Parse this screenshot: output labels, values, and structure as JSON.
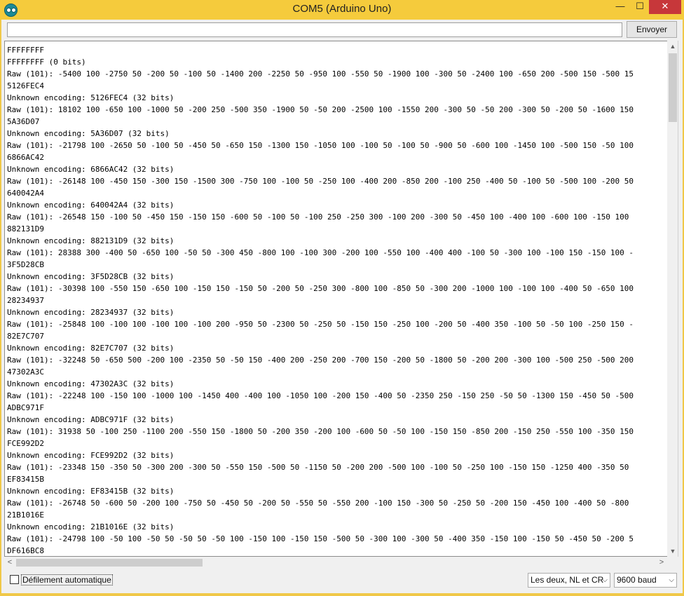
{
  "window": {
    "title": "COM5 (Arduino Uno)",
    "min_glyph": "—",
    "max_glyph": "☐",
    "close_glyph": "✕"
  },
  "toolbar": {
    "input_value": "",
    "send_label": "Envoyer"
  },
  "output": {
    "lines": [
      "FFFFFFFF",
      "FFFFFFFF (0 bits)",
      "Raw (101): -5400 100 -2750 50 -200 50 -100 50 -1400 200 -2250 50 -950 100 -550 50 -1900 100 -300 50 -2400 100 -650 200 -500 150 -500 15",
      "5126FEC4",
      "Unknown encoding: 5126FEC4 (32 bits)",
      "Raw (101): 18102 100 -650 100 -1000 50 -200 250 -500 350 -1900 50 -50 200 -2500 100 -1550 200 -300 50 -50 200 -300 50 -200 50 -1600 150",
      "5A36D07",
      "Unknown encoding: 5A36D07 (32 bits)",
      "Raw (101): -21798 100 -2650 50 -100 50 -450 50 -650 150 -1300 150 -1050 100 -100 50 -100 50 -900 50 -600 100 -1450 100 -500 150 -50 100",
      "6866AC42",
      "Unknown encoding: 6866AC42 (32 bits)",
      "Raw (101): -26148 100 -450 150 -300 150 -1500 300 -750 100 -100 50 -250 100 -400 200 -850 200 -100 250 -400 50 -100 50 -500 100 -200 50",
      "640042A4",
      "Unknown encoding: 640042A4 (32 bits)",
      "Raw (101): -26548 150 -100 50 -450 150 -150 150 -600 50 -100 50 -100 250 -250 300 -100 200 -300 50 -450 100 -400 100 -600 100 -150 100",
      "882131D9",
      "Unknown encoding: 882131D9 (32 bits)",
      "Raw (101): 28388 300 -400 50 -650 100 -50 50 -300 450 -800 100 -100 300 -200 100 -550 100 -400 400 -100 50 -300 100 -100 150 -150 100 -",
      "3F5D28CB",
      "Unknown encoding: 3F5D28CB (32 bits)",
      "Raw (101): -30398 100 -550 150 -650 100 -150 150 -150 50 -200 50 -250 300 -800 100 -850 50 -300 200 -1000 100 -100 100 -400 50 -650 100",
      "28234937",
      "Unknown encoding: 28234937 (32 bits)",
      "Raw (101): -25848 100 -100 100 -100 100 -100 200 -950 50 -2300 50 -250 50 -150 150 -250 100 -200 50 -400 350 -100 50 -50 100 -250 150 -",
      "82E7C707",
      "Unknown encoding: 82E7C707 (32 bits)",
      "Raw (101): -32248 50 -650 500 -200 100 -2350 50 -50 150 -400 200 -250 200 -700 150 -200 50 -1800 50 -200 200 -300 100 -500 250 -500 200",
      "47302A3C",
      "Unknown encoding: 47302A3C (32 bits)",
      "Raw (101): -22248 100 -150 100 -1000 100 -1450 400 -400 100 -1050 100 -200 150 -400 50 -2350 250 -150 250 -50 50 -1300 150 -450 50 -500",
      "ADBC971F",
      "Unknown encoding: ADBC971F (32 bits)",
      "Raw (101): 31938 50 -100 250 -1100 200 -550 150 -1800 50 -200 350 -200 100 -600 50 -50 100 -150 150 -850 200 -150 250 -550 100 -350 150",
      "FCE992D2",
      "Unknown encoding: FCE992D2 (32 bits)",
      "Raw (101): -23348 150 -350 50 -300 200 -300 50 -550 150 -500 50 -1150 50 -200 200 -500 100 -100 50 -250 100 -150 150 -1250 400 -350 50",
      "EF83415B",
      "Unknown encoding: EF83415B (32 bits)",
      "Raw (101): -26748 50 -600 50 -200 100 -750 50 -450 50 -200 50 -550 50 -550 200 -100 150 -300 50 -250 50 -200 150 -450 100 -400 50 -800",
      "21B1016E",
      "Unknown encoding: 21B1016E (32 bits)",
      "Raw (101): -24798 100 -50 100 -50 50 -50 50 -50 100 -150 100 -150 150 -500 50 -300 100 -300 50 -400 350 -150 100 -150 50 -450 50 -200 5",
      "DF616BC8"
    ]
  },
  "footer": {
    "autoscroll_label": "Défilement automatique",
    "autoscroll_checked": false,
    "line_ending": "Les deux, NL et CR",
    "baud_rate": "9600 baud"
  },
  "scrollbars": {
    "up": "▲",
    "down": "▼",
    "left": "<",
    "right": ">",
    "dropdown": "⌵"
  }
}
